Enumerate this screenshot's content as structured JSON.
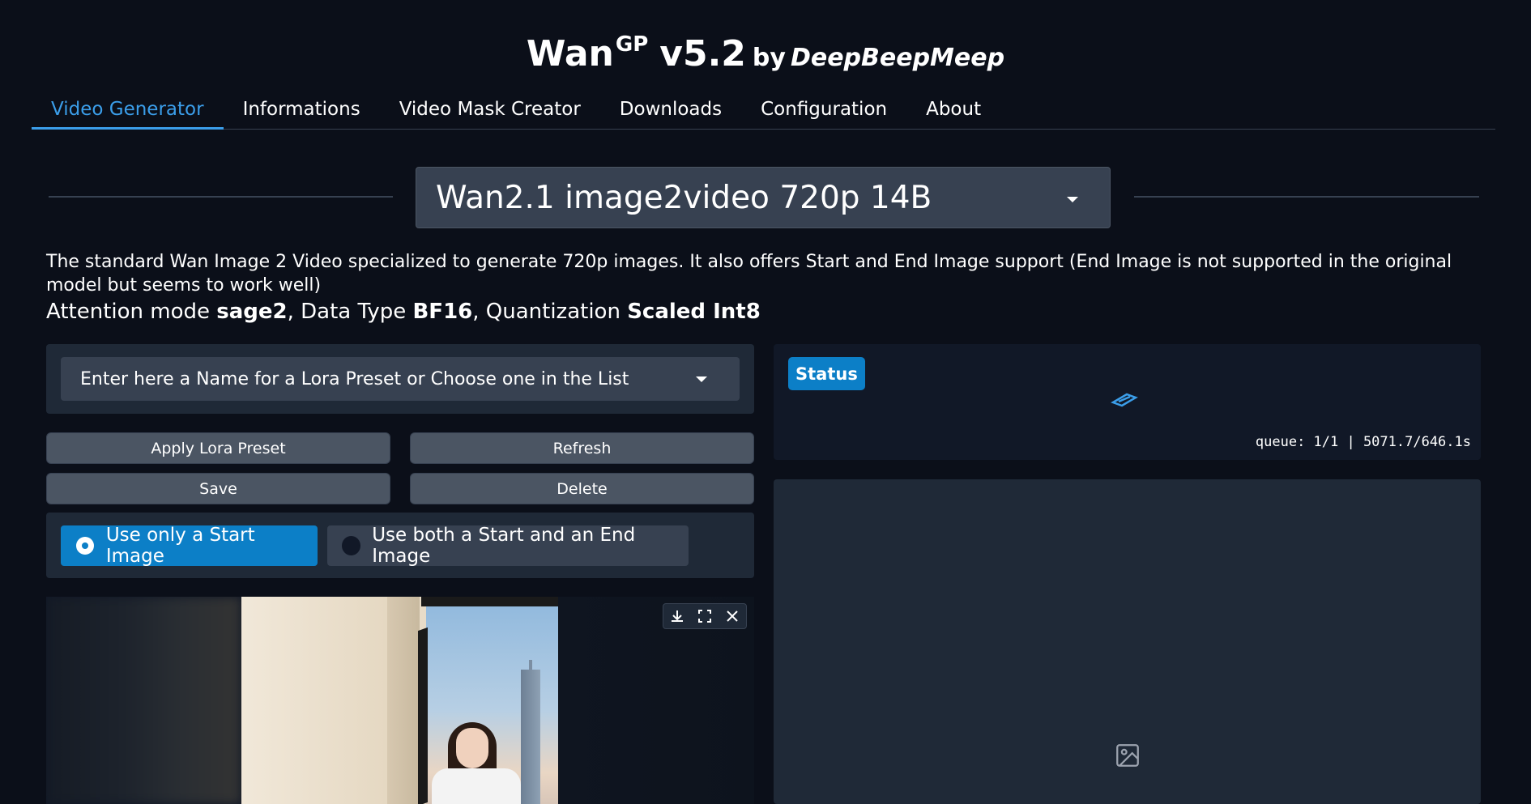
{
  "header": {
    "title_main": "Wan",
    "title_sup": "GP",
    "version": "v5.2",
    "by": "by",
    "author": "DeepBeepMeep"
  },
  "tabs": [
    {
      "label": "Video Generator",
      "active": true
    },
    {
      "label": "Informations",
      "active": false
    },
    {
      "label": "Video Mask Creator",
      "active": false
    },
    {
      "label": "Downloads",
      "active": false
    },
    {
      "label": "Configuration",
      "active": false
    },
    {
      "label": "About",
      "active": false
    }
  ],
  "model_selector": {
    "value": "Wan2.1 image2video 720p 14B"
  },
  "description": "The standard Wan Image 2 Video specialized to generate 720p images. It also offers Start and End Image support (End Image is not supported in the original model but seems to work well)",
  "attention": {
    "prefix": "Attention mode ",
    "mode": "sage2",
    "dt_prefix": ", Data Type ",
    "data_type": "BF16",
    "q_prefix": ", Quantization ",
    "quantization": "Scaled Int8"
  },
  "lora": {
    "placeholder": "Enter here a Name for a Lora Preset or Choose one in the List",
    "apply_label": "Apply Lora Preset",
    "refresh_label": "Refresh",
    "save_label": "Save",
    "delete_label": "Delete"
  },
  "image_mode": {
    "options": [
      {
        "label": "Use only a Start Image",
        "selected": true
      },
      {
        "label": "Use both a Start and an End Image",
        "selected": false
      }
    ]
  },
  "image_tools": {
    "download": "download-icon",
    "fullscreen": "fullscreen-icon",
    "close": "close-icon"
  },
  "status": {
    "label": "Status",
    "queue": "queue: 1/1 | 5071.7/646.1s"
  },
  "colors": {
    "background": "#0b0f19",
    "accent": "#0c7fc7",
    "tab_active": "#3b9eea",
    "panel": "#1f2937"
  }
}
